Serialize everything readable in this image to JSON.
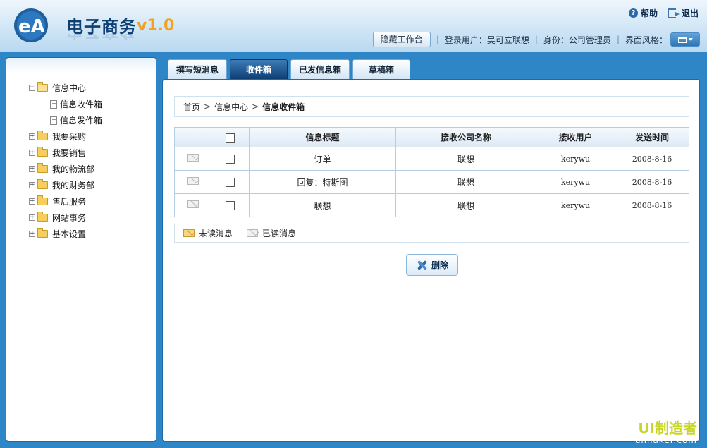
{
  "header": {
    "app_title": "电子商务",
    "version": "v1.0",
    "help_label": "帮助",
    "exit_label": "退出",
    "hide_workbench_label": "隐藏工作台",
    "login_user_label": "登录用户：吴可立联想",
    "role_label": "身份：公司管理员",
    "theme_label": "界面风格："
  },
  "sidebar": {
    "items": [
      {
        "label": "信息中心",
        "expanded": true
      },
      {
        "label": "信息收件箱"
      },
      {
        "label": "信息发件箱"
      },
      {
        "label": "我要采购"
      },
      {
        "label": "我要销售"
      },
      {
        "label": "我的物流部"
      },
      {
        "label": "我的财务部"
      },
      {
        "label": "售后服务"
      },
      {
        "label": "网站事务"
      },
      {
        "label": "基本设置"
      }
    ]
  },
  "tabs": [
    {
      "label": "撰写短消息"
    },
    {
      "label": "收件箱",
      "active": true
    },
    {
      "label": "已发信息箱"
    },
    {
      "label": "草稿箱"
    }
  ],
  "breadcrumb": {
    "home": "首页",
    "center": "信息中心",
    "current": "信息收件箱"
  },
  "table": {
    "columns": [
      "",
      "",
      "信息标题",
      "接收公司名称",
      "接收用户",
      "发送时间"
    ],
    "rows": [
      {
        "title": "订单",
        "company": "联想",
        "user": "kerywu",
        "time": "2008-8-16"
      },
      {
        "title": "回复：特斯图",
        "company": "联想",
        "user": "kerywu",
        "time": "2008-8-16"
      },
      {
        "title": "联想",
        "company": "联想",
        "user": "kerywu",
        "time": "2008-8-16"
      }
    ]
  },
  "legend": {
    "unread": "未读消息",
    "read": "已读消息"
  },
  "actions": {
    "delete": "删除"
  },
  "watermark": {
    "brand": "UI制造者",
    "url": "uimaker.com"
  },
  "colors": {
    "background": "#2f86c6",
    "active_tab": "#0e3f74",
    "version_accent": "#f2a21f"
  }
}
